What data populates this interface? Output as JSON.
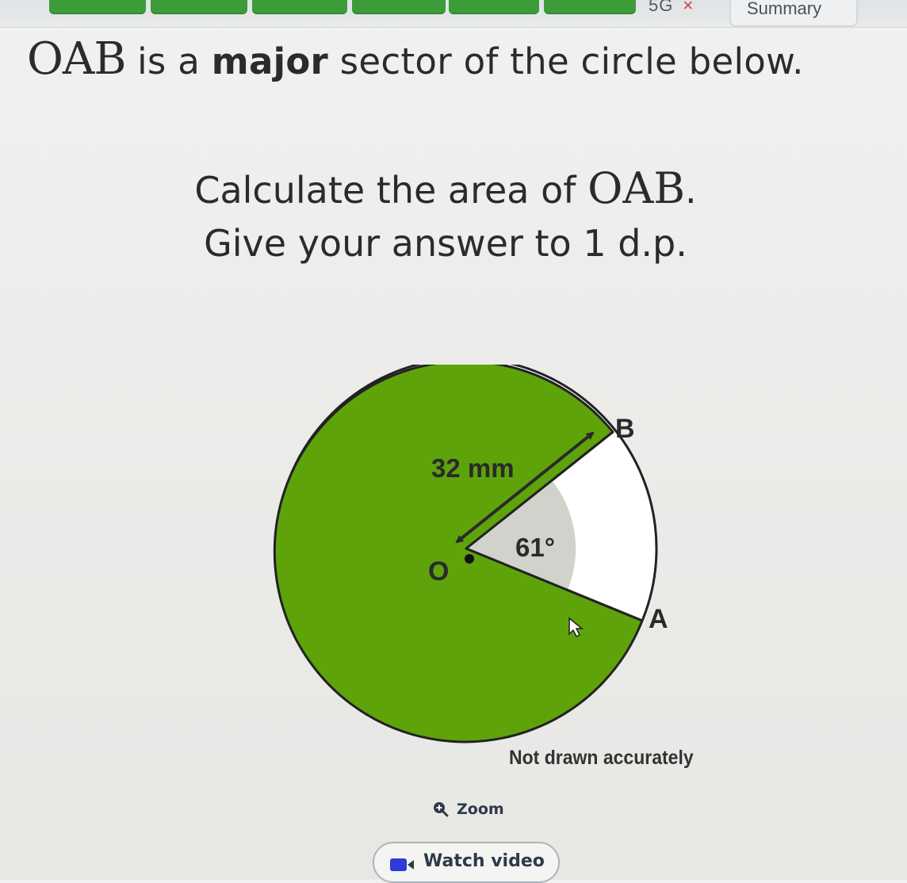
{
  "topbar": {
    "tab_label": "5G",
    "close_symbol": "×",
    "summary_label": "Summary",
    "tab_color": "#3d9c3a"
  },
  "question": {
    "title_math": "OAB",
    "title_text_1": " is a ",
    "title_bold": "major",
    "title_text_2": " sector of the circle below.",
    "line2_text": "Calculate the area of ",
    "line2_math": "OAB",
    "line2_end": ".",
    "line3_text": "Give your answer to 1 d.p."
  },
  "diagram": {
    "radius_label": "32 mm",
    "angle_label": "61°",
    "point_o": "O",
    "point_a": "A",
    "point_b": "B",
    "sector_color": "#5fa30b",
    "angle_marker_color": "#d2d2cc",
    "note": "Not drawn accurately"
  },
  "actions": {
    "zoom_label": "Zoom",
    "zoom_icon": "zoom-in-icon",
    "watch_label": "Watch video",
    "watch_icon": "video-camera-icon"
  }
}
